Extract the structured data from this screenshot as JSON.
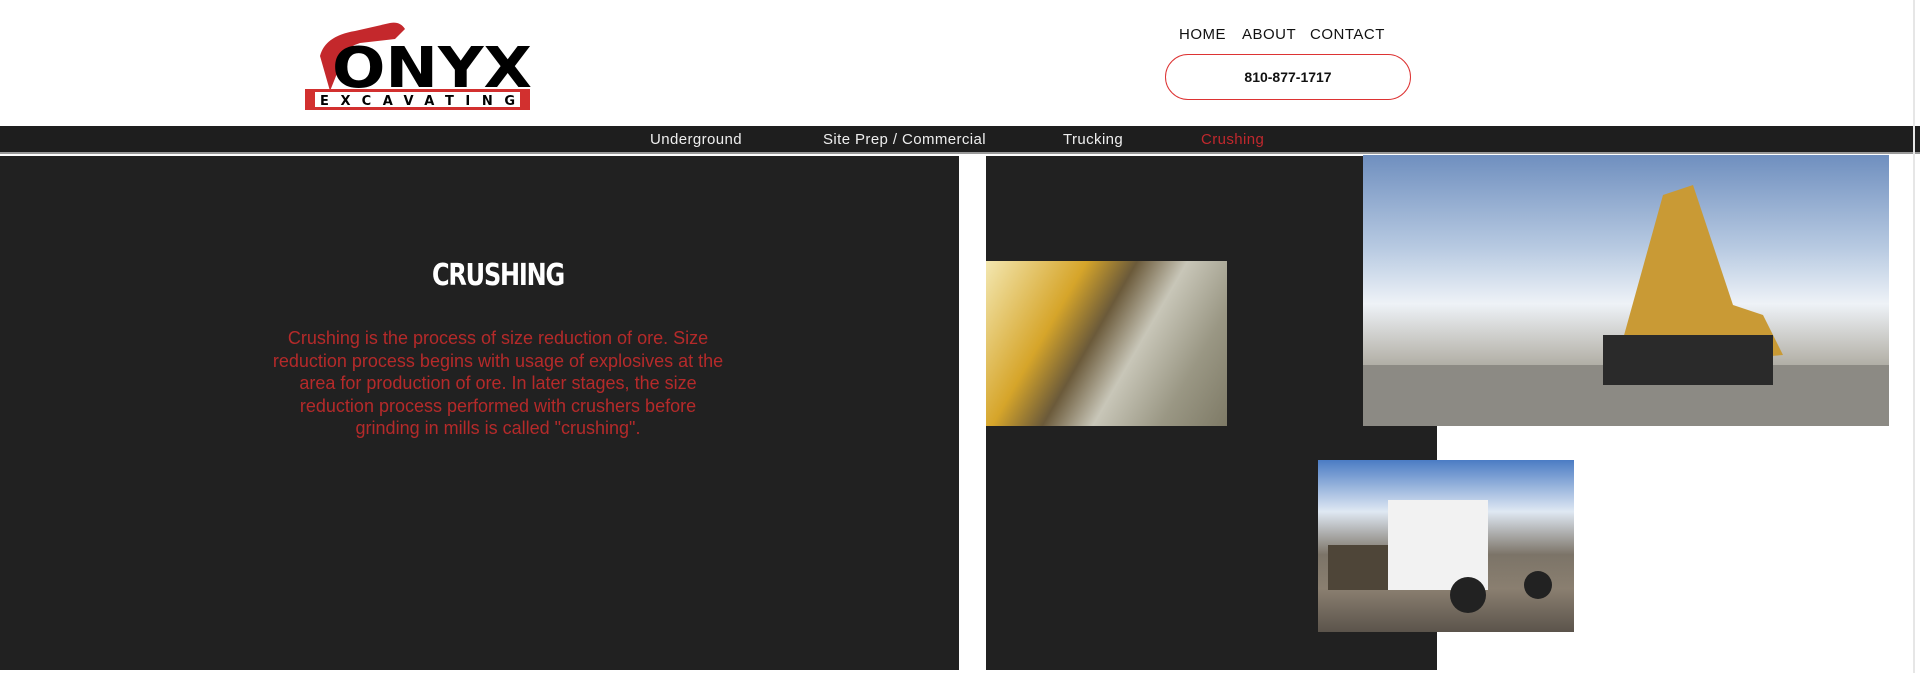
{
  "header": {
    "logo_text": "ONYX",
    "logo_subtext": "EXCAVATING",
    "nav": [
      "HOME",
      "ABOUT",
      "CONTACT"
    ],
    "phone": "810-877-1717"
  },
  "subnav": {
    "items": [
      "Underground",
      "Site Prep / Commercial",
      "Trucking",
      "Crushing"
    ],
    "active": "Crushing"
  },
  "main": {
    "title": "CRUSHING",
    "description": "Crushing is the process of size reduction of ore. Size reduction process begins with usage of explosives at the area for production of ore. In later stages, the size reduction process performed with crushers before grinding in mills is called \"crushing\"."
  },
  "colors": {
    "accent": "#c0282d",
    "dark": "#212121"
  }
}
